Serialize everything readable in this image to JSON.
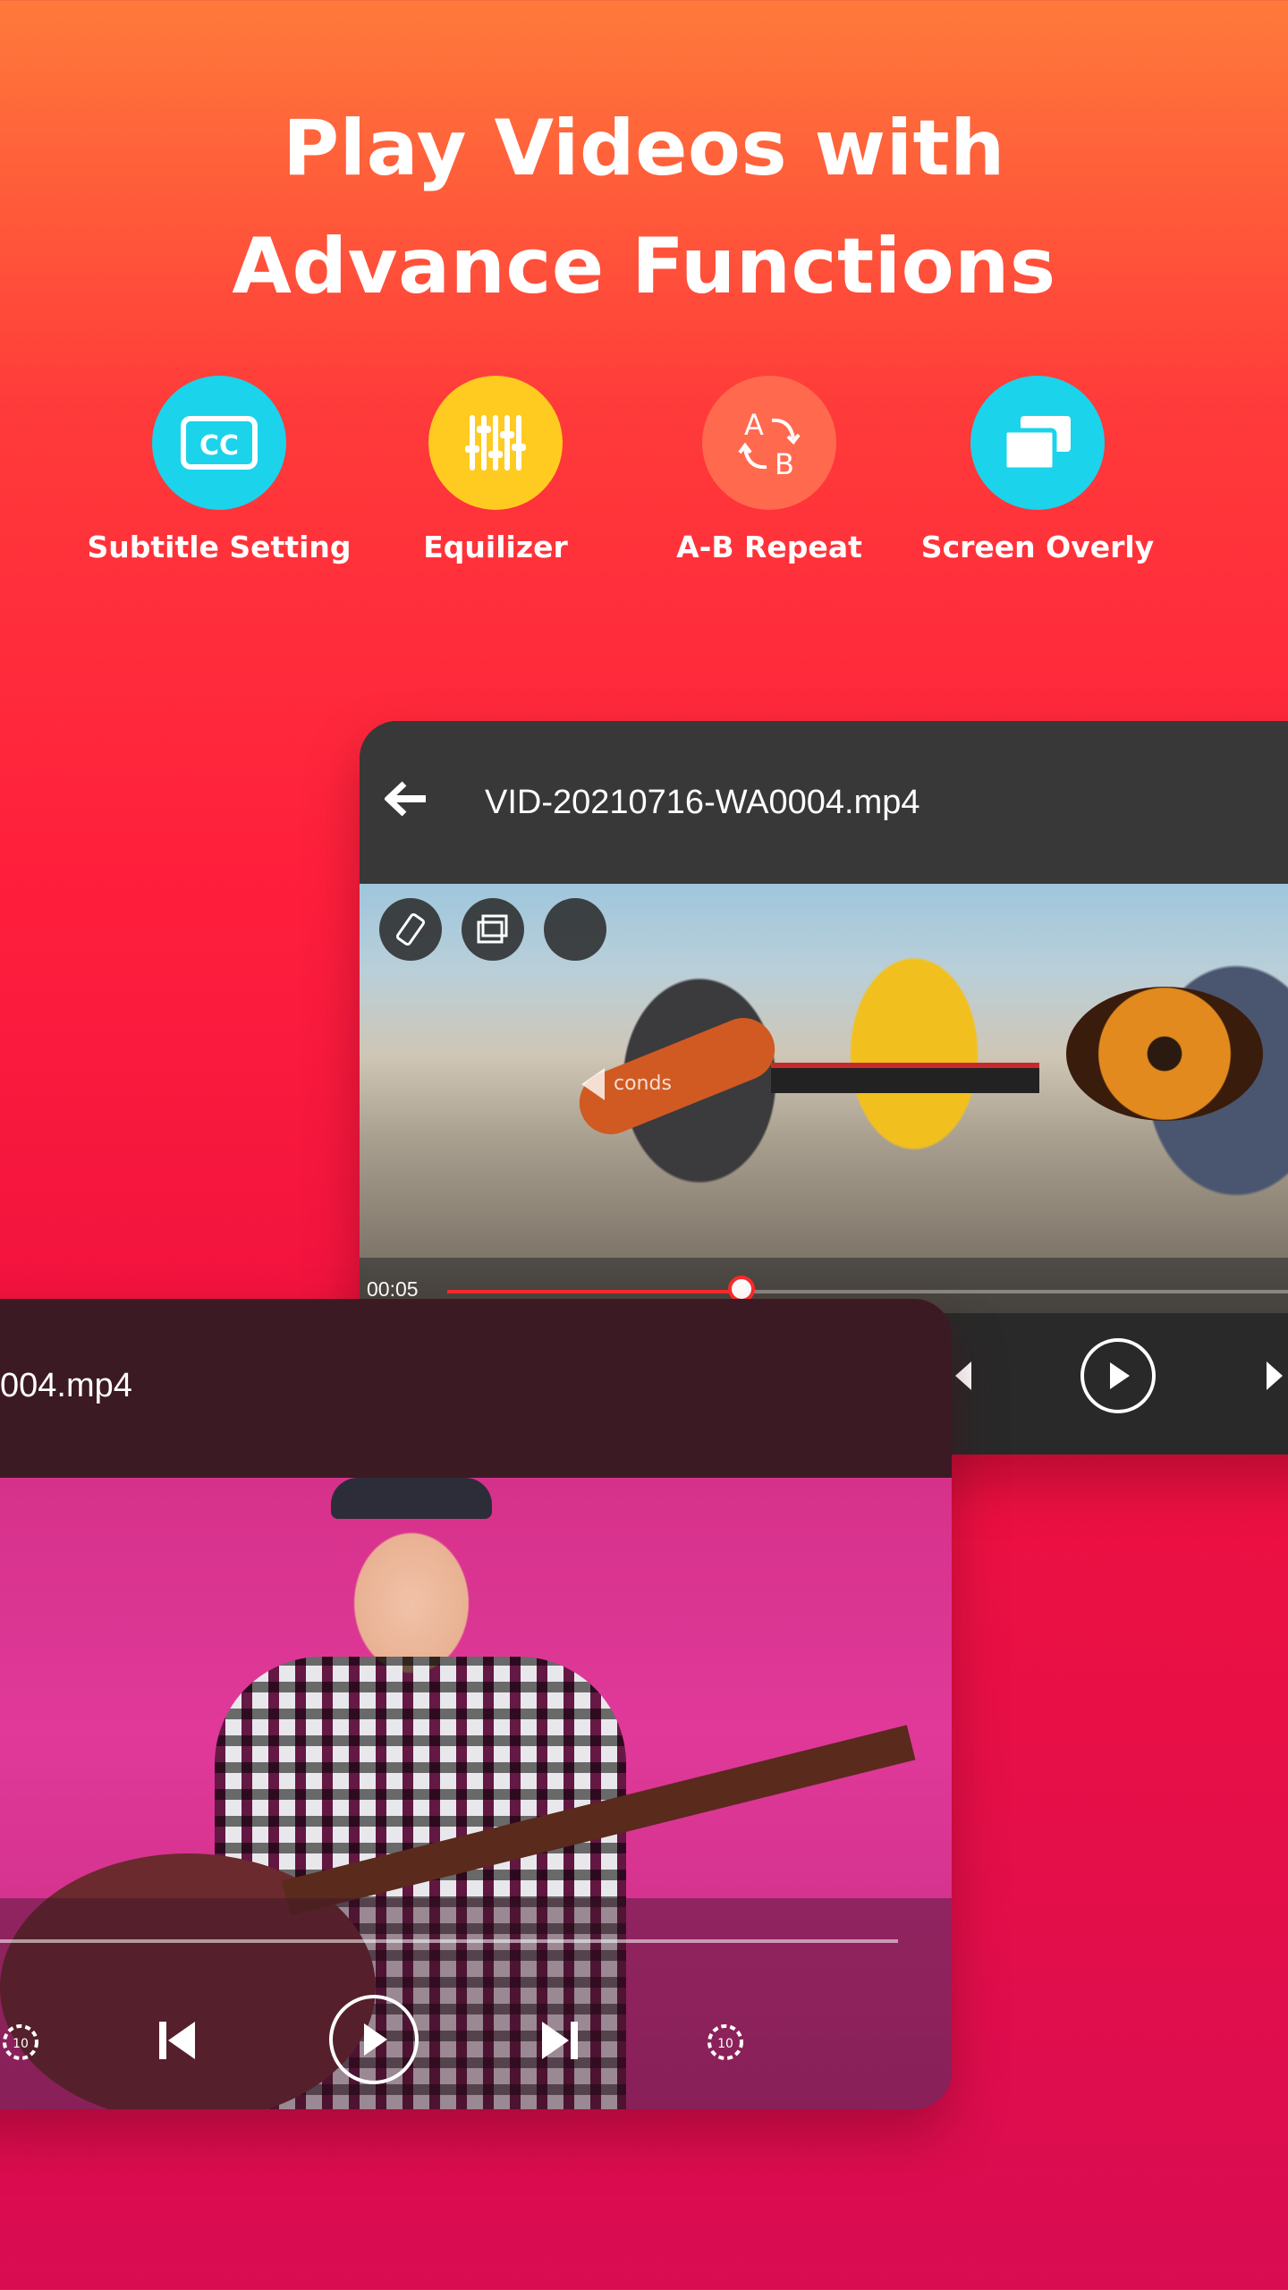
{
  "headline": {
    "line1": "Play Videos with",
    "line2": "Advance Functions"
  },
  "features": [
    {
      "label": "Subtitle Setting",
      "icon": "cc-icon",
      "color": "#1bd3ea"
    },
    {
      "label": "Equilizer",
      "icon": "equalizer-icon",
      "color": "#ffcb21"
    },
    {
      "label": "A-B Repeat",
      "icon": "ab-repeat-icon",
      "color": "#ff6a4f"
    },
    {
      "label": "Screen Overly",
      "icon": "screen-overlay-icon",
      "color": "#1bd3ea"
    }
  ],
  "player_top": {
    "file_name": "VID-20210716-WA0004.mp4",
    "current_time": "00:05",
    "seek_hint": "conds",
    "progress_percent": 28
  },
  "player_bottom": {
    "file_name": "004.mp4"
  },
  "colors": {
    "accent": "#ff2a2a",
    "cyan": "#1bd3ea",
    "yellow": "#ffcb21",
    "salmon": "#ff6a4f"
  }
}
